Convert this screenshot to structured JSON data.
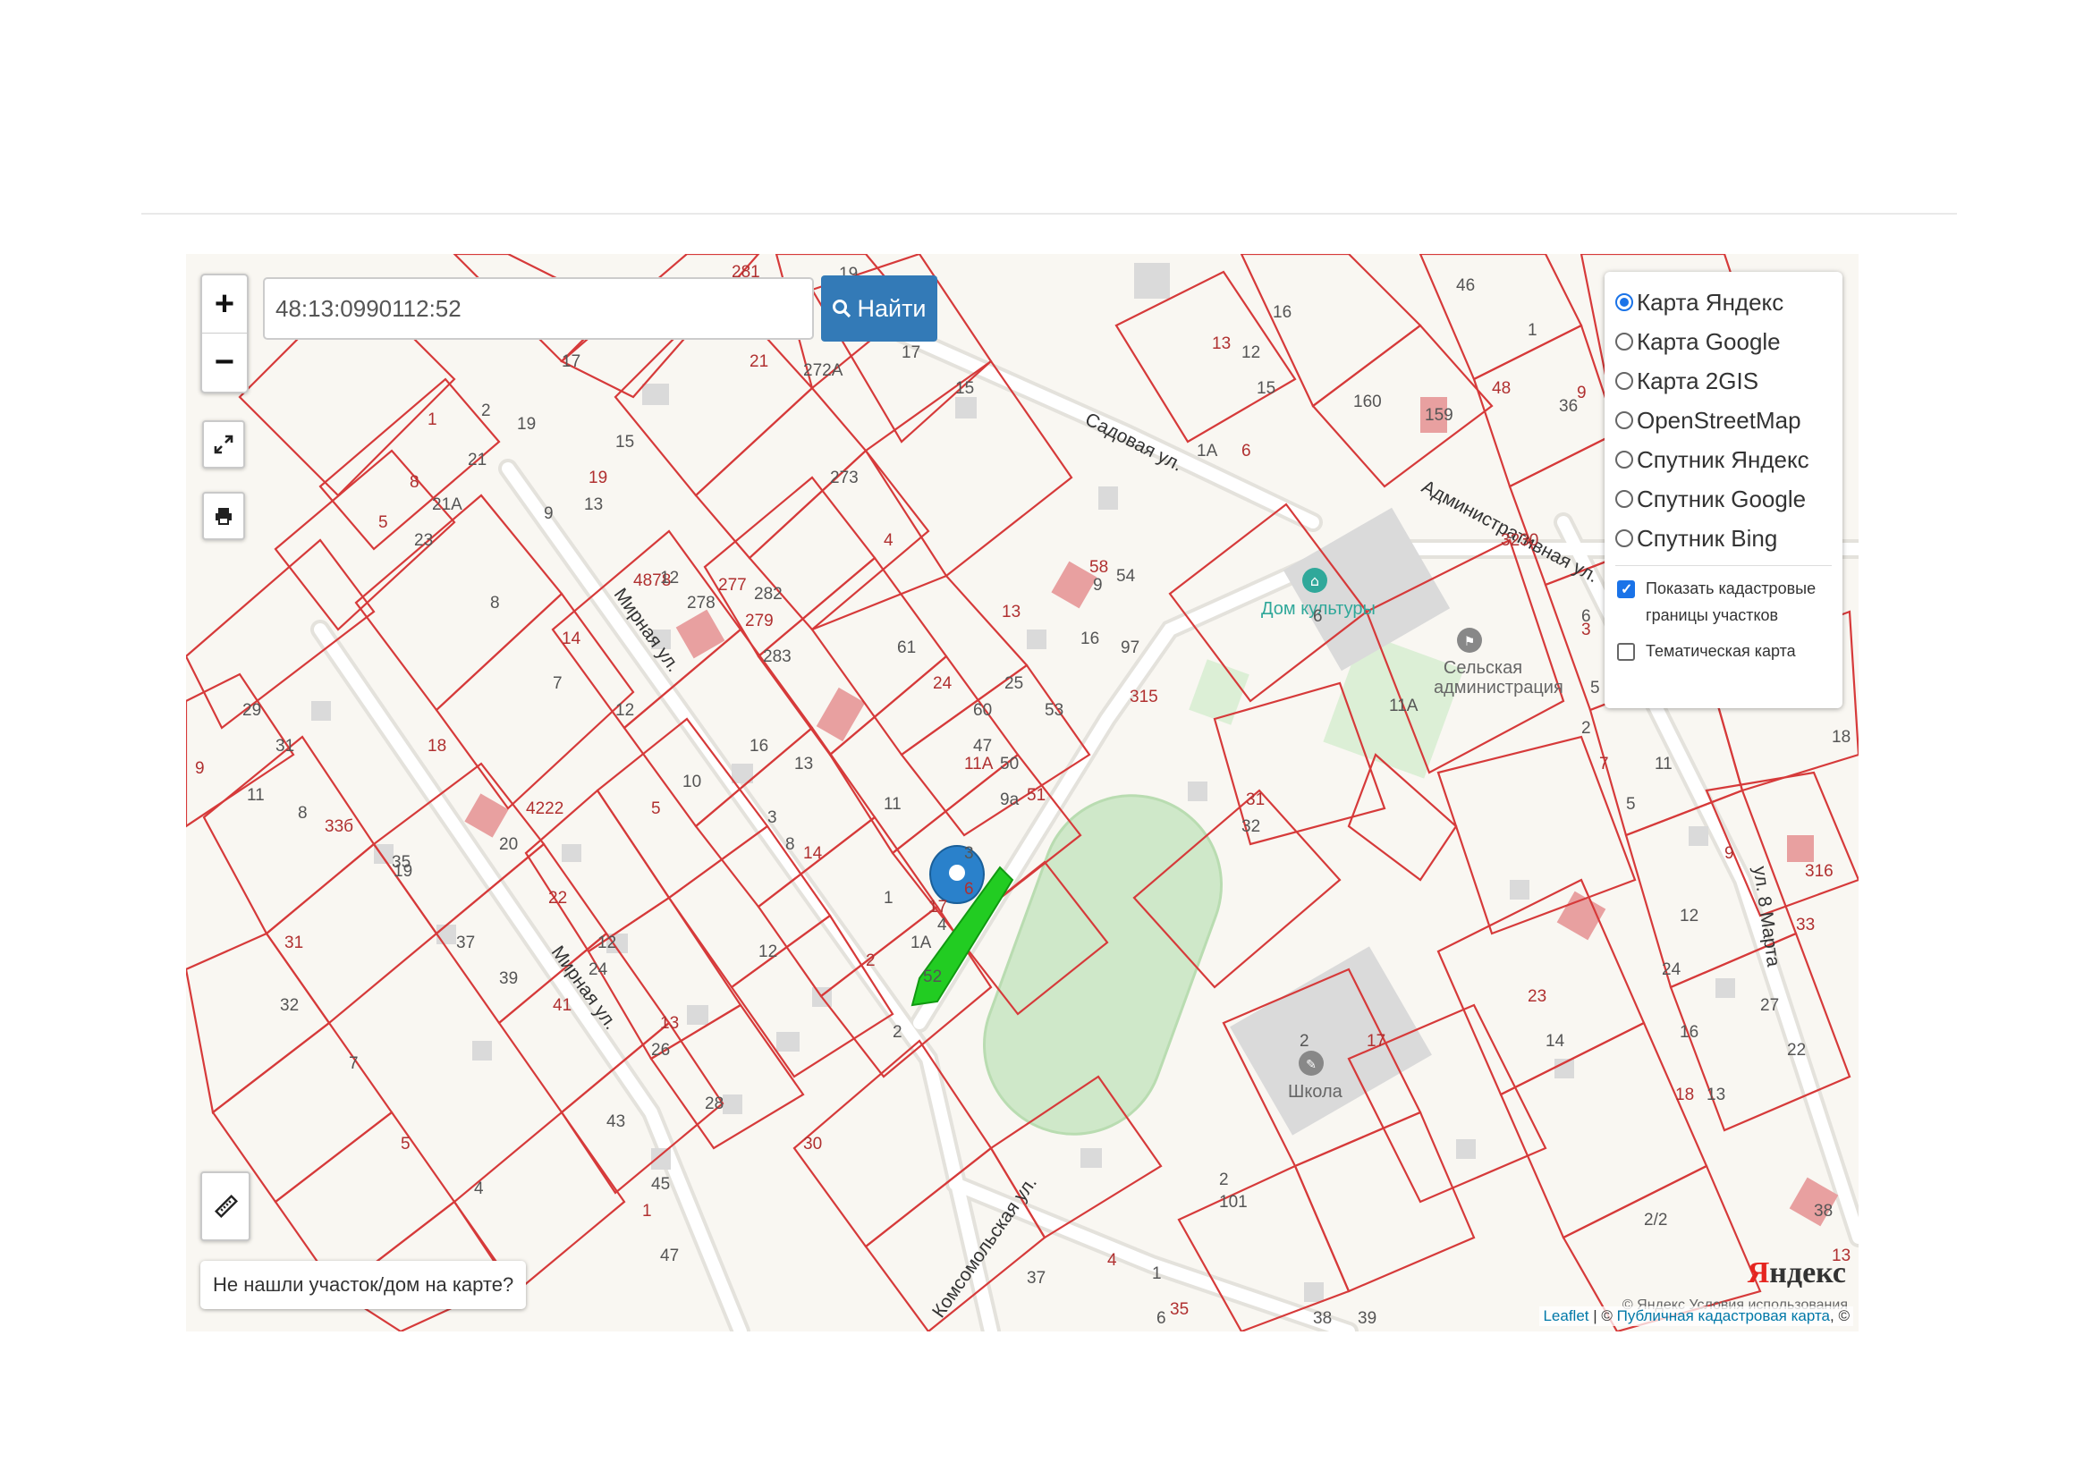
{
  "search": {
    "value": "48:13:0990112:52",
    "button_label": "Найти"
  },
  "zoom": {
    "in_label": "+",
    "out_label": "−"
  },
  "layers": {
    "options": [
      {
        "label": "Карта Яндекс",
        "selected": true
      },
      {
        "label": "Карта Google",
        "selected": false
      },
      {
        "label": "Карта 2GIS",
        "selected": false
      },
      {
        "label": "OpenStreetMap",
        "selected": false
      },
      {
        "label": "Спутник Яндекс",
        "selected": false
      },
      {
        "label": "Спутник Google",
        "selected": false
      },
      {
        "label": "Спутник Bing",
        "selected": false
      }
    ],
    "show_cadastral_label": "Показать кадастровые границы участков",
    "show_cadastral_checked": true,
    "thematic_label": "Тематическая карта",
    "thematic_checked": false
  },
  "not_found_label": "Не нашли участок/дом на карте?",
  "attribution": {
    "leaflet": "Leaflet",
    "sep": " | © ",
    "pkk": "Публичная кадастровая карта",
    "tail": ", ©"
  },
  "yandex_logo": {
    "first": "Я",
    "rest": "ндекс"
  },
  "yandex_terms": "© Яндекс  Условия использования",
  "streets": {
    "mirnaya1": "Мирная ул.",
    "mirnaya2": "Мирная ул.",
    "sadovaya": "Садовая ул.",
    "administrativnaya": "Административная ул.",
    "komsomolskaya": "Комсомольская ул.",
    "marta": "ул. 8 Марта"
  },
  "pois": {
    "dom_kultury": "Дом культуры",
    "admin": "Сельская администрация",
    "school": "Школа"
  },
  "plot_numbers": [
    "281",
    "19",
    "17",
    "21",
    "272А",
    "273",
    "4",
    "15",
    "17",
    "1",
    "2",
    "21",
    "8",
    "21А",
    "23",
    "5",
    "19",
    "15",
    "19",
    "13",
    "9",
    "4878",
    "12",
    "278",
    "277",
    "282",
    "283",
    "279",
    "16",
    "8",
    "14",
    "7",
    "12",
    "18",
    "29",
    "31",
    "9",
    "11",
    "8",
    "33б",
    "35",
    "19",
    "4222",
    "20",
    "10",
    "5",
    "13",
    "3",
    "14",
    "11",
    "1",
    "17",
    "1А",
    "52",
    "22",
    "37",
    "39",
    "41",
    "12",
    "24",
    "13",
    "26",
    "28",
    "30",
    "43",
    "45",
    "1",
    "47",
    "12",
    "31",
    "32",
    "7",
    "5",
    "4",
    "8",
    "6",
    "3",
    "4",
    "2",
    "2",
    "61",
    "24",
    "60",
    "47",
    "11А",
    "50",
    "9а",
    "51",
    "53",
    "25",
    "13",
    "16",
    "54",
    "58",
    "9",
    "97",
    "315",
    "38",
    "32",
    "31",
    "6",
    "11А",
    "3230",
    "160",
    "159",
    "48",
    "46",
    "1",
    "9",
    "36",
    "16",
    "13",
    "15",
    "12",
    "6",
    "1А",
    "6",
    "3",
    "2",
    "5",
    "7",
    "11",
    "5",
    "9",
    "12",
    "24",
    "23",
    "14",
    "16",
    "18",
    "13",
    "27",
    "33",
    "22",
    "2/2",
    "13",
    "38",
    "18",
    "316",
    "39",
    "2",
    "17",
    "2",
    "101",
    "4",
    "6",
    "1",
    "35",
    "37"
  ],
  "colors": {
    "parcel": "#d63a3a",
    "selected": "#22cc22",
    "marker": "#2a81cb",
    "stadium": "#cfe8c9",
    "road": "#ffffff"
  }
}
